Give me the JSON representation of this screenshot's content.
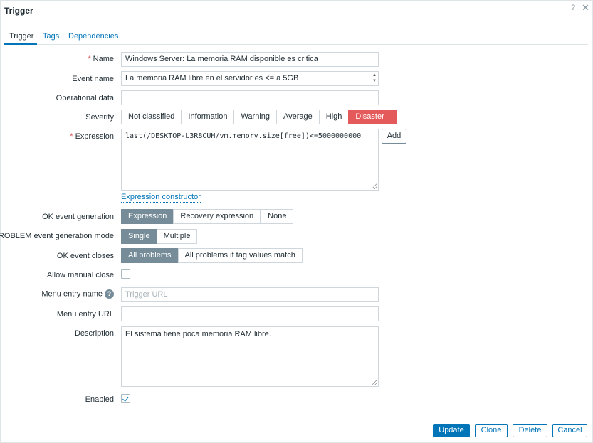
{
  "dialog": {
    "title": "Trigger",
    "help": "?",
    "close": "✕"
  },
  "tabs": [
    {
      "label": "Trigger",
      "active": true
    },
    {
      "label": "Tags",
      "active": false
    },
    {
      "label": "Dependencies",
      "active": false
    }
  ],
  "form": {
    "name": {
      "label": "Name",
      "required": "*",
      "value": "Windows Server: La memoria RAM disponible es critica"
    },
    "event_name": {
      "label": "Event name",
      "value": "La memoria RAM libre en el servidor es <= a 5GB"
    },
    "operational_data": {
      "label": "Operational data",
      "value": ""
    },
    "severity": {
      "label": "Severity",
      "options": [
        "Not classified",
        "Information",
        "Warning",
        "Average",
        "High",
        "Disaster"
      ],
      "selected": "Disaster"
    },
    "expression": {
      "label": "Expression",
      "required": "*",
      "value": "last(/DESKTOP-L3R8CUH/vm.memory.size[free])<=5000000000",
      "add_label": "Add",
      "constructor_link": "Expression constructor"
    },
    "ok_event_generation": {
      "label": "OK event generation",
      "options": [
        "Expression",
        "Recovery expression",
        "None"
      ],
      "selected": "Expression"
    },
    "problem_mode": {
      "label": "PROBLEM event generation mode",
      "options": [
        "Single",
        "Multiple"
      ],
      "selected": "Single"
    },
    "ok_event_closes": {
      "label": "OK event closes",
      "options": [
        "All problems",
        "All problems if tag values match"
      ],
      "selected": "All problems"
    },
    "allow_manual_close": {
      "label": "Allow manual close",
      "checked": false
    },
    "menu_entry_name": {
      "label": "Menu entry name",
      "help": "?",
      "placeholder": "Trigger URL",
      "value": ""
    },
    "menu_entry_url": {
      "label": "Menu entry URL",
      "value": ""
    },
    "description": {
      "label": "Description",
      "value": "El sistema tiene poca memoria RAM libre."
    },
    "enabled": {
      "label": "Enabled",
      "checked": true
    }
  },
  "footer": {
    "update": "Update",
    "clone": "Clone",
    "delete": "Delete",
    "cancel": "Cancel"
  },
  "colors": {
    "accent": "#0275b8",
    "disaster": "#e45959",
    "selected": "#768d99",
    "required": "#e45959"
  }
}
